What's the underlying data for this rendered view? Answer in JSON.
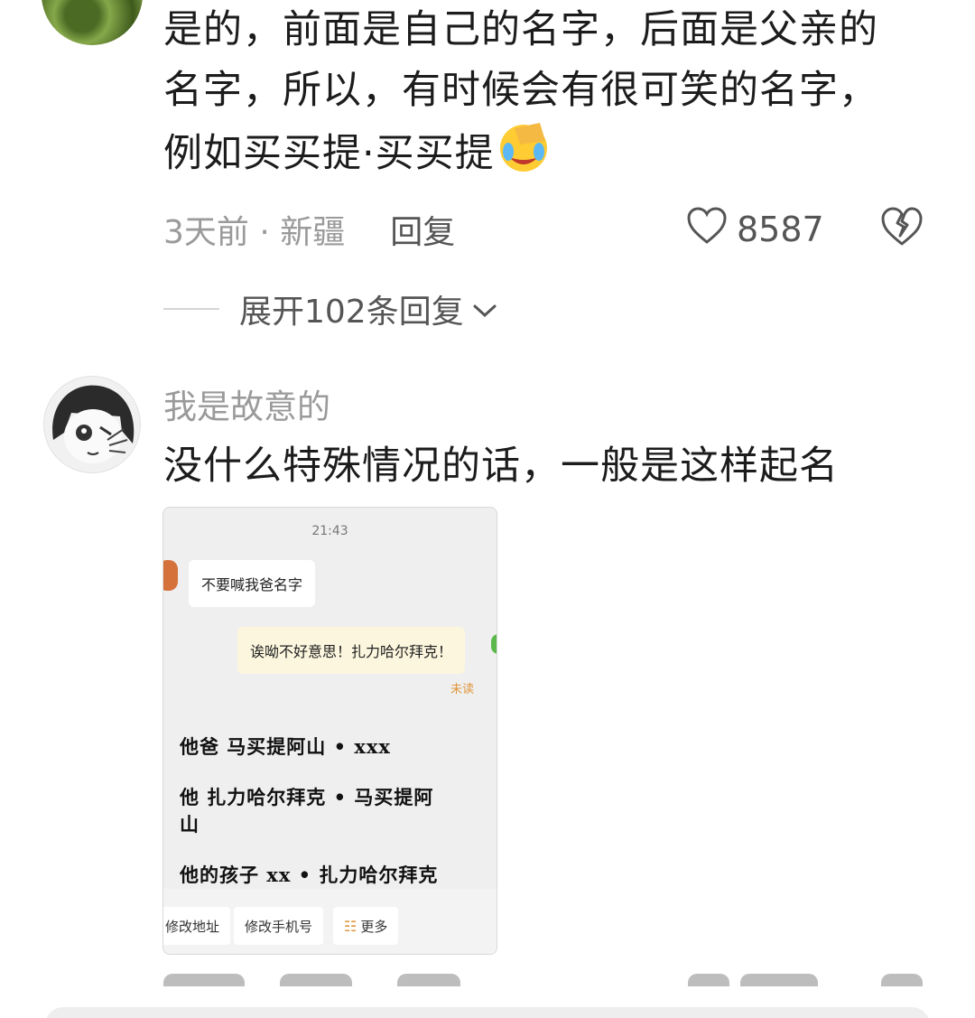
{
  "comment1": {
    "body_lines": [
      "是的，前面是自己的名字，后面是父亲的",
      "名字，所以，有时候会有很可笑的名字，",
      "例如买买提·买买提"
    ],
    "emoji": "laughing-crying-emoji",
    "time_location": "3天前 · 新疆",
    "reply_label": "回复",
    "like_count": "8587",
    "expand_label": "展开102条回复"
  },
  "comment2": {
    "username": "我是故意的",
    "body": "没什么特殊情况的话，一般是这样起名",
    "image": {
      "time": "21:43",
      "left_message": "不要喊我爸名字",
      "right_message": "诶呦不好意思！扎力哈尔拜克！",
      "unread_label": "未读",
      "handwritten_lines": [
        "他爸  马买提阿山 • xxx",
        "他  扎力哈尔拜克 • 马买提阿山",
        "他的孩子  xx • 扎力哈尔拜克"
      ],
      "bottom_buttons": [
        "修改地址",
        "修改手机号",
        "更多"
      ]
    }
  },
  "icons": {
    "heart": "heart-outline-icon",
    "broken_heart": "broken-heart-icon",
    "chevron": "chevron-down-icon",
    "more_grid": "grid-icon"
  },
  "colors": {
    "meta_text": "#9a9a9a",
    "body_text": "#1c1c1c",
    "unread": "#e0963c"
  }
}
